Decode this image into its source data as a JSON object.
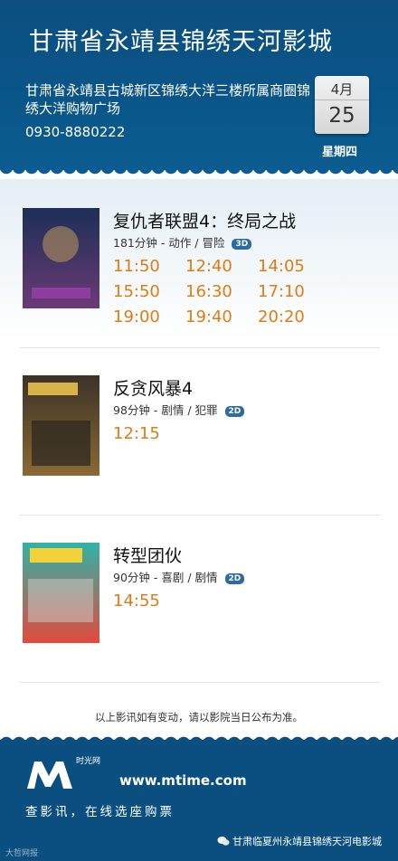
{
  "header": {
    "title": "甘肃省永靖县锦绣天河影城",
    "address": "甘肃省永靖县古城新区锦绣大洋三楼所属商圈锦绣大洋购物广场",
    "phone": "0930-8880222",
    "date": {
      "month": "4月",
      "day": "25",
      "weekday": "星期四"
    }
  },
  "movies": [
    {
      "title": "复仇者联盟4：终局之战",
      "meta": "181分钟 - 动作 / 冒险",
      "format": "3D",
      "times": [
        "11:50",
        "12:40",
        "14:05",
        "15:50",
        "16:30",
        "17:10",
        "19:00",
        "19:40",
        "20:20"
      ],
      "poster_colors": [
        "#1d2f57",
        "#6a3b74"
      ]
    },
    {
      "title": "反贪风暴4",
      "meta": "98分钟 - 剧情 / 犯罪",
      "format": "2D",
      "times": [
        "12:15"
      ],
      "poster_colors": [
        "#3b3228",
        "#8a6a34"
      ]
    },
    {
      "title": "转型团伙",
      "meta": "90分钟 - 喜剧 / 剧情",
      "format": "2D",
      "times": [
        "14:55"
      ],
      "poster_colors": [
        "#2fb3a7",
        "#e24a3c"
      ]
    }
  ],
  "notice": "以上影讯如有变动，请以影院当日公布为准。",
  "footer": {
    "brand_small": "时光网",
    "url": "www.mtime.com",
    "tagline": "查影讯，在线选座购票",
    "wechat": "甘肃临夏州永靖县锦绣天河电影城",
    "watermark": "大哲网报"
  }
}
